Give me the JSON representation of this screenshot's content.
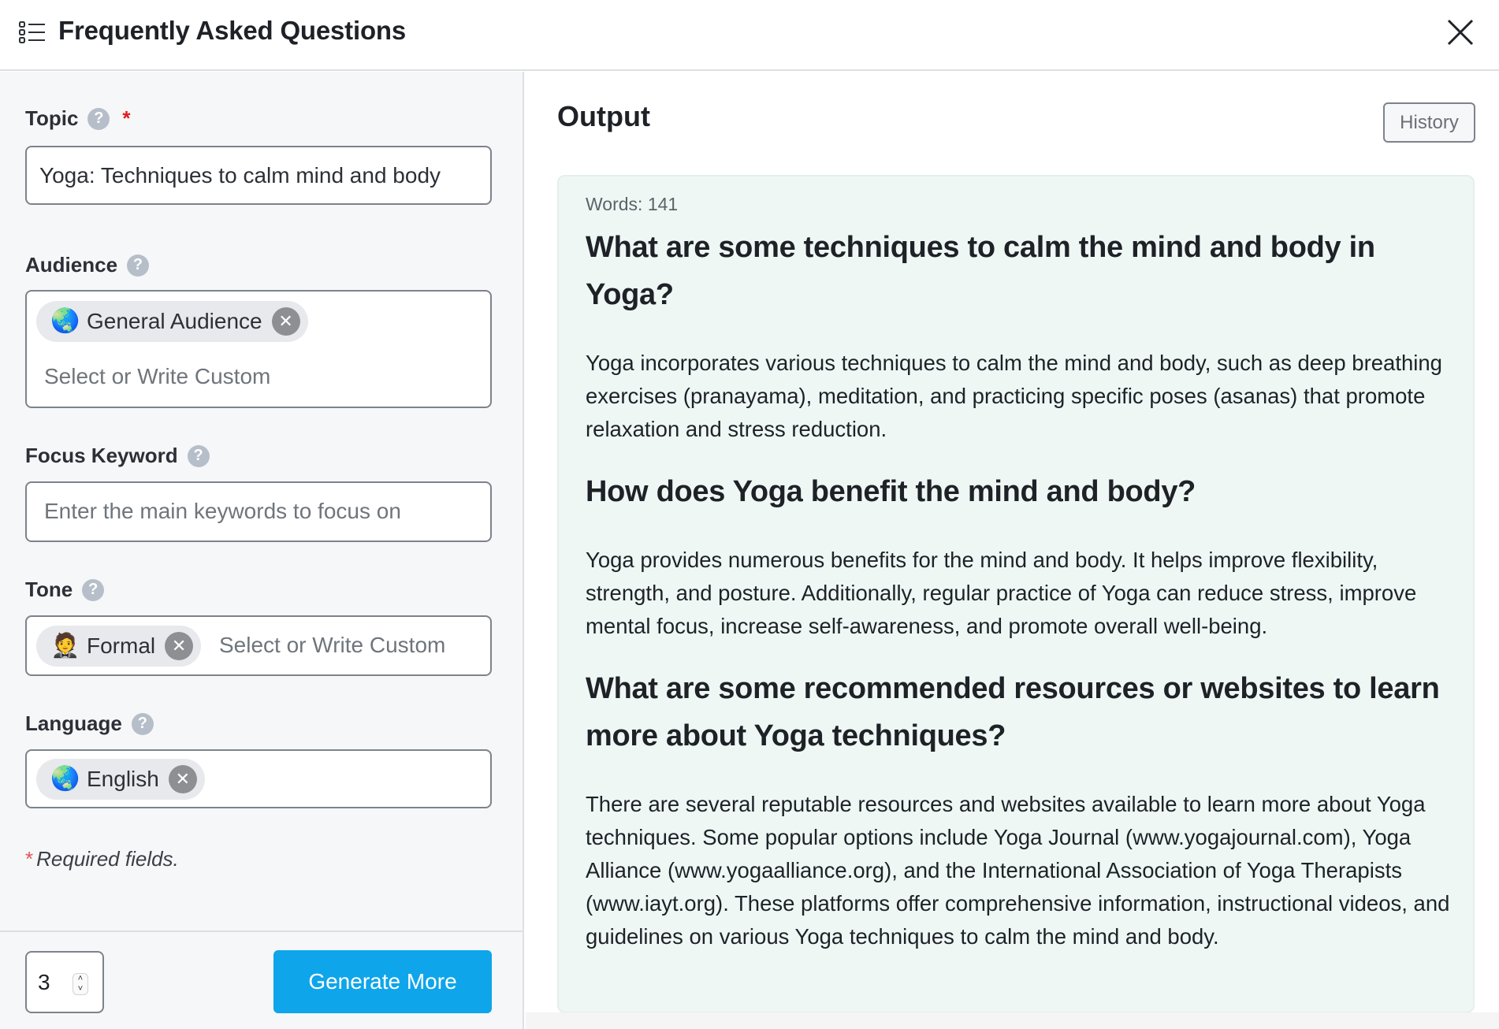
{
  "header": {
    "title": "Frequently Asked Questions",
    "icon": "list-icon",
    "close_icon": "close-icon"
  },
  "form": {
    "topic": {
      "label": "Topic",
      "required": true,
      "required_mark": "*",
      "help_icon": "?",
      "value": "Yoga: Techniques to calm mind and body"
    },
    "audience": {
      "label": "Audience",
      "help_icon": "?",
      "chips": [
        {
          "emoji": "🌏",
          "label": "General Audience",
          "remove": "✕"
        }
      ],
      "placeholder": "Select or Write Custom"
    },
    "focus_keyword": {
      "label": "Focus Keyword",
      "help_icon": "?",
      "value": "",
      "placeholder": "Enter the main keywords to focus on"
    },
    "tone": {
      "label": "Tone",
      "help_icon": "?",
      "chips": [
        {
          "emoji": "🤵",
          "label": "Formal",
          "remove": "✕"
        }
      ],
      "placeholder": "Select or Write Custom"
    },
    "language": {
      "label": "Language",
      "help_icon": "?",
      "chips": [
        {
          "emoji": "🌏",
          "label": "English",
          "remove": "✕"
        }
      ]
    },
    "required_note": {
      "star": "*",
      "text": "Required fields."
    }
  },
  "footer": {
    "count": "3",
    "spin_up": "˄",
    "spin_down": "˅",
    "generate_label": "Generate More"
  },
  "output": {
    "title": "Output",
    "history_label": "History",
    "words_label": "Words: 141",
    "faqs": [
      {
        "question": "What are some techniques to calm the mind and body in Yoga?",
        "answer": "Yoga incorporates various techniques to calm the mind and body, such as deep breathing exercises (pranayama), meditation, and practicing specific poses (asanas) that promote relaxation and stress reduction."
      },
      {
        "question": "How does Yoga benefit the mind and body?",
        "answer": "Yoga provides numerous benefits for the mind and body. It helps improve flexibility, strength, and posture. Additionally, regular practice of Yoga can reduce stress, improve mental focus, increase self-awareness, and promote overall well-being."
      },
      {
        "question": "What are some recommended resources or websites to learn more about Yoga techniques?",
        "answer": "There are several reputable resources and websites available to learn more about Yoga techniques. Some popular options include Yoga Journal (www.yogajournal.com), Yoga Alliance (www.yogaalliance.org), and the International Association of Yoga Therapists (www.iayt.org). These platforms offer comprehensive information, instructional videos, and guidelines on various Yoga techniques to calm the mind and body."
      }
    ]
  },
  "colors": {
    "accent": "#0ea5ea",
    "required": "#e11d1d",
    "output_bg": "#eff7f5",
    "panel_bg": "#f6f7f9"
  }
}
